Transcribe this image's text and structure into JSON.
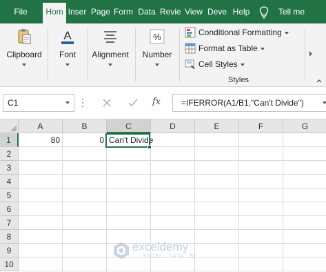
{
  "tabs": [
    {
      "label": "File",
      "active": false
    },
    {
      "label": "Hom",
      "active": true
    },
    {
      "label": "Inser",
      "active": false
    },
    {
      "label": "Page",
      "active": false
    },
    {
      "label": "Form",
      "active": false
    },
    {
      "label": "Data",
      "active": false
    },
    {
      "label": "Revie",
      "active": false
    },
    {
      "label": "View",
      "active": false
    },
    {
      "label": "Deve",
      "active": false
    },
    {
      "label": "Help",
      "active": false
    }
  ],
  "tell_me": "Tell me",
  "ribbon": {
    "clipboard": "Clipboard",
    "font": "Font",
    "alignment": "Alignment",
    "number": "Number",
    "conditional_formatting": "Conditional Formatting",
    "format_as_table": "Format as Table",
    "cell_styles": "Cell Styles",
    "styles_group": "Styles"
  },
  "formula_bar": {
    "name_box": "C1",
    "fx": "fx",
    "formula": "=IFERROR(A1/B1,\"Can't Divide\")"
  },
  "sheet": {
    "columns": [
      "A",
      "B",
      "C",
      "D",
      "E",
      "F",
      "G"
    ],
    "rows": [
      "1",
      "2",
      "3",
      "4",
      "5",
      "6",
      "7",
      "8",
      "9",
      "10"
    ],
    "selected_column": "C",
    "selected_row": "1",
    "cells": {
      "A1": "80",
      "B1": "0",
      "C1": "Can't Divide"
    }
  },
  "watermark": {
    "name": "exceldemy",
    "tagline": "EXCEL · DATA · BI"
  },
  "colors": {
    "accent": "#217346",
    "ribbon_bg": "#f3f3f3",
    "header_bg": "#e6e6e6"
  }
}
